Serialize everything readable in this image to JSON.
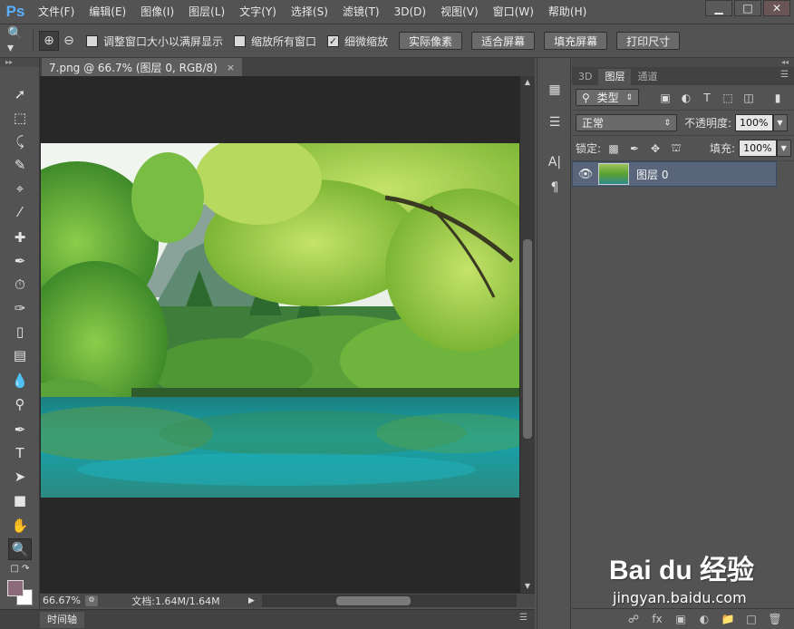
{
  "app": {
    "logo_text": "Ps"
  },
  "menubar": {
    "items": [
      "文件(F)",
      "编辑(E)",
      "图像(I)",
      "图层(L)",
      "文字(Y)",
      "选择(S)",
      "滤镜(T)",
      "3D(D)",
      "视图(V)",
      "窗口(W)",
      "帮助(H)"
    ]
  },
  "window_controls": {
    "minimize": "▁",
    "maximize": "□",
    "close": "✕"
  },
  "options_bar": {
    "checkboxes": [
      {
        "label": "调整窗口大小以满屏显示",
        "checked": false
      },
      {
        "label": "缩放所有窗口",
        "checked": false
      },
      {
        "label": "细微缩放",
        "checked": true
      }
    ],
    "buttons": [
      "实际像素",
      "适合屏幕",
      "填充屏幕",
      "打印尺寸"
    ]
  },
  "document": {
    "tab_title": "7.png @ 66.7% (图层 0, RGB/8)",
    "close_glyph": "×"
  },
  "status_bar": {
    "zoom": "66.67%",
    "doc_size": "文档:1.64M/1.64M"
  },
  "timeline": {
    "tab_label": "时间轴"
  },
  "panels": {
    "tabs": [
      {
        "label": "3D",
        "active": false
      },
      {
        "label": "图层",
        "active": true
      },
      {
        "label": "通道",
        "active": false
      }
    ],
    "filter_kind": "类型",
    "blend_mode": "正常",
    "opacity_label": "不透明度:",
    "opacity_value": "100%",
    "lock_label": "锁定:",
    "fill_label": "填充:",
    "fill_value": "100%",
    "layers": [
      {
        "name": "图层 0",
        "visible": true,
        "selected": true
      }
    ]
  },
  "watermark": {
    "logo": "Bai du 经验",
    "url": "jingyan.baidu.com"
  },
  "colors": {
    "foreground": "#8b6b7a",
    "background": "#ffffff",
    "selected_layer": "#59657a",
    "ui_panel": "#535353",
    "canvas_bg": "#282828"
  }
}
